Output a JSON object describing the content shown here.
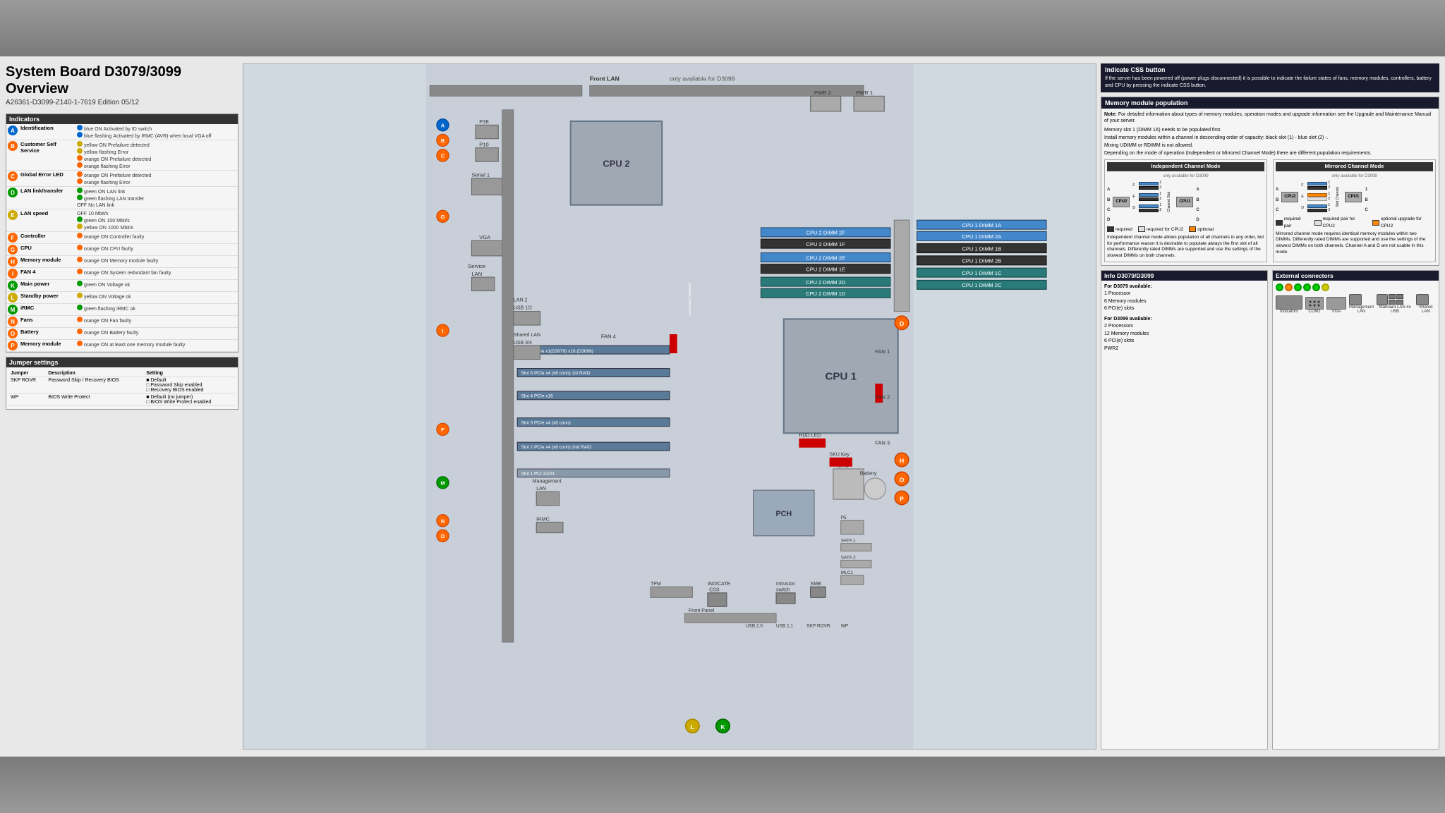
{
  "page": {
    "background_color": "#7a7a7a",
    "document_background": "#e8e8e8"
  },
  "header": {
    "main_title": "System Board D3079/3099 Overview",
    "subtitle": "A26361-D3099-Z140-1-7619  Edition 05/12"
  },
  "indicators_section": {
    "title": "Indicators",
    "items": [
      {
        "letter": "A",
        "color": "blue",
        "label": "Identification",
        "states": [
          {
            "state": "blue ON",
            "desc": "Activated by ID switch"
          },
          {
            "state": "blue flashing",
            "desc": "Activated by iRMC (AVR) when local VGA off"
          }
        ]
      },
      {
        "letter": "B",
        "color": "orange",
        "label": "Customer Self Service",
        "states": [
          {
            "state": "yellow ON",
            "desc": "Prefailure detected"
          },
          {
            "state": "yellow flashing",
            "desc": "Error"
          },
          {
            "state": "orange ON",
            "desc": "Prefailure detected"
          },
          {
            "state": "orange flashing",
            "desc": "Error"
          }
        ]
      },
      {
        "letter": "C",
        "color": "orange",
        "label": "Global Error LED",
        "states": [
          {
            "state": "orange ON",
            "desc": "Prefailure detected"
          },
          {
            "state": "orange flashing",
            "desc": "Error"
          }
        ]
      },
      {
        "letter": "D",
        "color": "green",
        "label": "LAN link/transfer",
        "states": [
          {
            "state": "green ON",
            "desc": "LAN link"
          },
          {
            "state": "green flashing",
            "desc": "LAN transfer"
          },
          {
            "state": "OFF",
            "desc": "No LAN link"
          }
        ]
      },
      {
        "letter": "E",
        "color": "yellow",
        "label": "LAN speed",
        "states": [
          {
            "state": "OFF",
            "desc": "10 Mbit/s"
          },
          {
            "state": "green ON",
            "desc": "100 Mbit/s"
          },
          {
            "state": "yellow ON",
            "desc": "1000 Mbit/s"
          }
        ]
      },
      {
        "letter": "F",
        "color": "orange",
        "label": "Controller",
        "states": [
          {
            "state": "orange ON",
            "desc": "Controller faulty"
          }
        ]
      },
      {
        "letter": "G",
        "color": "orange",
        "label": "CPU",
        "states": [
          {
            "state": "orange ON",
            "desc": "CPU faulty"
          }
        ]
      },
      {
        "letter": "H",
        "color": "orange",
        "label": "Memory module",
        "states": [
          {
            "state": "orange ON",
            "desc": "Memory module faulty"
          }
        ]
      },
      {
        "letter": "I",
        "color": "orange",
        "label": "FAN 4",
        "states": [
          {
            "state": "orange ON",
            "desc": "System redundant fan faulty"
          }
        ]
      },
      {
        "letter": "K",
        "color": "green",
        "label": "Main power",
        "states": [
          {
            "state": "green ON",
            "desc": "Voltage ok"
          }
        ]
      },
      {
        "letter": "L",
        "color": "yellow",
        "label": "Standby power",
        "states": [
          {
            "state": "yellow ON",
            "desc": "Voltage ok"
          }
        ]
      },
      {
        "letter": "M",
        "color": "green",
        "label": "iRMC",
        "states": [
          {
            "state": "green flashing",
            "desc": "iRMC ok"
          }
        ]
      },
      {
        "letter": "N",
        "color": "orange",
        "label": "Fans",
        "states": [
          {
            "state": "orange ON",
            "desc": "Fan faulty"
          }
        ]
      },
      {
        "letter": "O",
        "color": "orange",
        "label": "Battery",
        "states": [
          {
            "state": "orange ON",
            "desc": "Battery faulty"
          }
        ]
      },
      {
        "letter": "P",
        "color": "orange",
        "label": "Memory module",
        "states": [
          {
            "state": "orange ON",
            "desc": "at least one memory module faulty"
          }
        ]
      }
    ]
  },
  "jumper_section": {
    "title": "Jumper settings",
    "headers": [
      "Jumper",
      "Description",
      "Setting"
    ],
    "items": [
      {
        "jumper": "SKP ROVR",
        "description": "Password Skip / Recovery BIOS",
        "settings": [
          "Default",
          "Password Skip enabled",
          "Recovery BIOS enabled"
        ]
      },
      {
        "jumper": "WP",
        "description": "BIOS Write Protect",
        "settings": [
          "Default (no jumper)",
          "BIOS Write Protect enabled"
        ]
      }
    ]
  },
  "board_diagram": {
    "front_lan_label": "Front LAN",
    "only_d3099_label": "only available for D3099",
    "cpu_labels": [
      "CPU 1",
      "CPU 2"
    ],
    "dimm_slots_cpu1": [
      "CPU 1 DIMM 1A",
      "CPU 1 DIMM 2A",
      "CPU 1 DIMM 1B",
      "CPU 1 DIMM 2B",
      "CPU 1 DIMM 1C",
      "CPU 1 DIMM 2C"
    ],
    "dimm_slots_cpu2": [
      "CPU 2 DIMM 2F",
      "CPU 2 DIMM 1F",
      "CPU 2 DIMM 2E",
      "CPU 2 DIMM 1E",
      "CPU 2 DIMM 2D",
      "CPU 2 DIMM 1D"
    ],
    "pcie_slots": [
      "Slot 6 PCIe x1(D3079)    x16 (D3099)",
      "Slot 5 PCIe x4 (x8 conn)  1st RAID",
      "Slot 4 PCIe x16",
      "Slot 3 PCIe x4 (x8 conn)",
      "Slot 2 PCIe x4 (x8 conn)  2nd RAID",
      "Slot 1 PCI 32/33"
    ],
    "connectors": [
      "P38",
      "P10",
      "Serial 1",
      "VGA",
      "Service LAN",
      "LAN 2",
      "USB 1/2",
      "Shared LAN",
      "USB 3/4",
      "Management LAN",
      "FAN 4",
      "iRMC",
      "PCH",
      "UFM",
      "Battery",
      "FAN 1",
      "FAN 2",
      "FAN 3",
      "SATA 1",
      "SATA 2",
      "MLC1",
      "TPM",
      "Front Panel",
      "HDD LED",
      "SKU Key",
      "INDICATE CSS",
      "Intrusion switch",
      "SMB",
      "USB 2.0",
      "USB 1.1",
      "SKP ROVR",
      "WP"
    ]
  },
  "indicate_css": {
    "title": "Indicate CSS button",
    "text": "If the server has been powered off (power plugs disconnected) it is possible to indicate the failure states of fans, memory modules, controllers, battery and CPU by pressing the indicate CSS button."
  },
  "memory_population": {
    "title": "Memory module population",
    "note": "Note: For detailed information about types of memory modules, operation modes and upgrade information see the Upgrade and Maintenance Manual of your server.",
    "rules": [
      "Memory slot 1 (DIMM 1A) needs to be populated first.",
      "Install memory modules within a channel in descending order of capacity: black slot (1) - blue slot (2) -.",
      "Mixing UDIMM or RDIMM is not allowed.",
      "Depending on the mode of operation (Independent or Mirrored Channel Mode) there are different population requirements."
    ],
    "independent_channel": {
      "title": "Independent Channel Mode",
      "subtitle": "only available for D3099",
      "channels": [
        "A",
        "B",
        "C",
        "D"
      ],
      "slot_labels": [
        "F",
        "E",
        "D"
      ],
      "slots_per_channel": 2
    },
    "mirrored_channel": {
      "title": "Mirrored Channel Mode",
      "subtitle": "only available for D3099",
      "channels": [
        "A",
        "B",
        "C"
      ],
      "slot_labels": [
        "F",
        "E",
        "D"
      ],
      "slots_per_channel": 2
    },
    "legend": {
      "required": "required",
      "required_cpu2": "required for CPU2",
      "optional": "optional",
      "required_pair": "required pair",
      "required_pair_cpu2": "required pair for CPU2",
      "optional_upgrade": "optional upgrade for CPU2"
    },
    "independent_text": "Independent channel mode allows population of all channels in any order, but for performance reason it is desirable to populate always the first slot of all channels. Differently rated DIMMs are supported and use the settings of the slowest DIMMs on both channels.",
    "mirrored_text": "Mirrored channel mode requires identical memory modules within two DIMMs. Differently rated DIMMs are supported and use the settings of the slowest DIMMs on both channels. Channel A and D are not usable in this mode."
  },
  "info_d3079": {
    "title": "Info D3079/D3099",
    "d3079_label": "For D3079 available:",
    "d3079_items": [
      "1 Processor",
      "6 Memory modules",
      "6 PCI(e) slots"
    ],
    "d3099_label": "For D3099 available:",
    "d3099_items": [
      "2 Processors",
      "12 Memory modules",
      "6 PCI(e) slots",
      "PWR2"
    ]
  },
  "external_connectors": {
    "title": "External connectors",
    "ports": [
      {
        "label": "Indicators",
        "type": "dots"
      },
      {
        "label": "COM1",
        "type": "serial"
      },
      {
        "label": "VGA",
        "type": "vga"
      },
      {
        "label": "Management LAN",
        "type": "rj45"
      },
      {
        "label": "Standard LAN 4x USB",
        "type": "rj45"
      },
      {
        "label": "Shared LAN",
        "type": "rj45"
      }
    ],
    "indicator_dots": [
      "green",
      "orange",
      "green",
      "green",
      "green",
      "yellow"
    ]
  }
}
